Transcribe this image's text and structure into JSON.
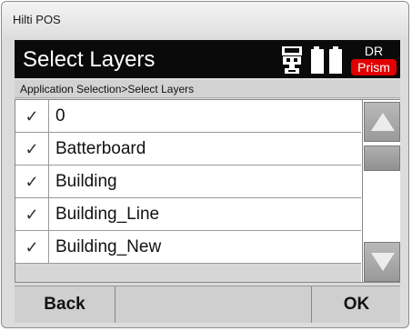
{
  "window": {
    "title": "Hilti POS"
  },
  "header": {
    "title": "Select Layers",
    "mode_label": "DR",
    "target_badge": "Prism",
    "icons": [
      "total-station-icon",
      "battery-icon"
    ],
    "colors": {
      "background": "#0a0a0a",
      "badge": "#e10000"
    }
  },
  "breadcrumb": "Application Selection>Select Layers",
  "layers": {
    "items": [
      {
        "label": "0",
        "checked": true
      },
      {
        "label": "Batterboard",
        "checked": true
      },
      {
        "label": "Building",
        "checked": true
      },
      {
        "label": "Building_Line",
        "checked": true
      },
      {
        "label": "Building_New",
        "checked": true
      }
    ],
    "check_glyph": "✓"
  },
  "scrollbar": {
    "icons": [
      "arrow-up-icon",
      "arrow-down-icon"
    ]
  },
  "softkeys": {
    "back_label": "Back",
    "ok_label": "OK"
  }
}
